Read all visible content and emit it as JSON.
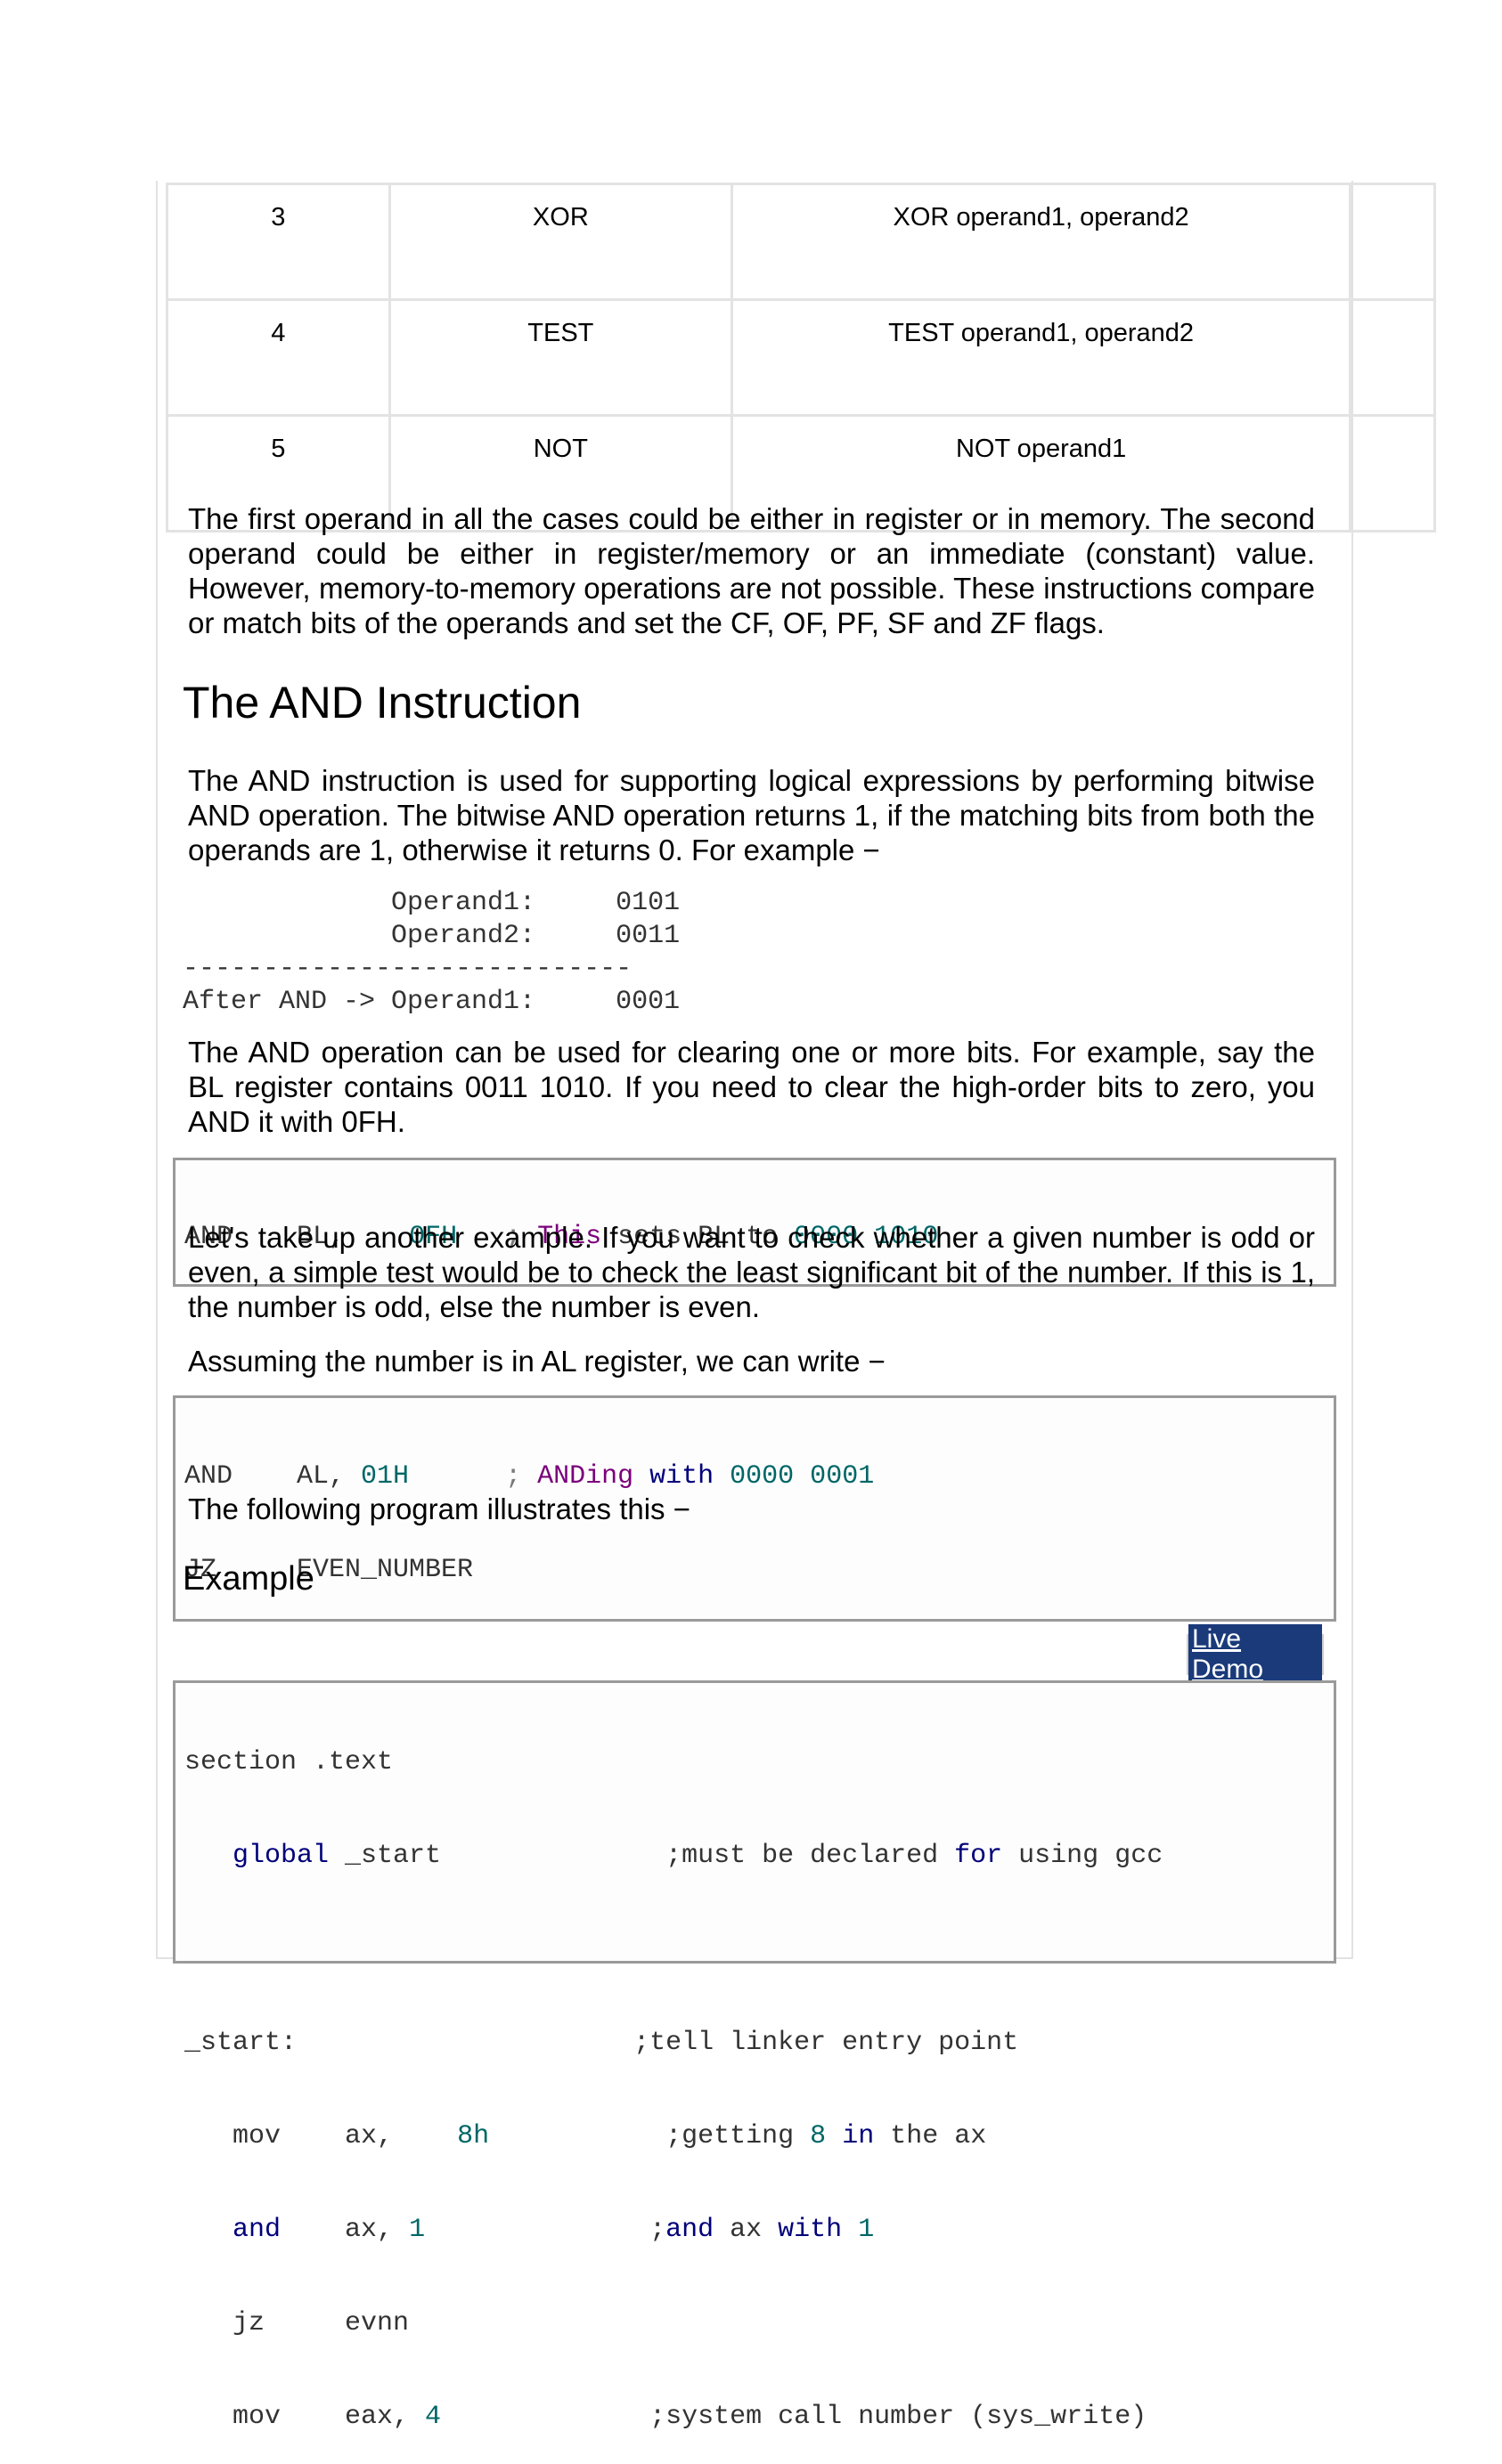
{
  "table": {
    "rows": [
      {
        "num": "3",
        "instr": "XOR",
        "format": "XOR operand1, operand2"
      },
      {
        "num": "4",
        "instr": "TEST",
        "format": "TEST operand1, operand2"
      },
      {
        "num": "5",
        "instr": "NOT",
        "format": "NOT operand1"
      }
    ]
  },
  "para_operands": "The first operand in all the cases could be either in register or in memory. The second operand could be either in register/memory or an immediate (constant) value. However, memory-to-memory operations are not possible. These instructions compare or match bits of the operands and set the CF, OF, PF, SF and ZF flags.",
  "heading_and": "The AND Instruction",
  "para_and": "The AND instruction is used for supporting logical expressions by performing bitwise AND operation. The bitwise AND operation returns 1, if the matching bits from both the operands are 1, otherwise it returns 0. For example −",
  "bitwise_example": {
    "line1": "             Operand1:     0101",
    "line2": "             Operand2:     0011",
    "line3": "----------------------------",
    "line4": "After AND -> Operand1:     0001"
  },
  "para_clear": "The AND operation can be used for clearing one or more bits. For example, say the BL register contains 0011 1010. If you need to clear the high-order bits to zero, you AND it with 0FH.",
  "code1": {
    "op": "AND    ",
    "reg": "BL,    ",
    "imm": "0FH",
    "gap": "   ",
    "semi": "; ",
    "c1": "This",
    "c2": " sets BL to ",
    "c3": "0000 1010"
  },
  "para_odd": "Let's take up another example. If you want to check whether a given number is odd or even, a simple test would be to check the least significant bit of the number. If this is 1, the number is odd, else the number is even.",
  "para_assume": "Assuming the number is in AL register, we can write −",
  "code2": {
    "l1_op": "AND    ",
    "l1_reg": "AL, ",
    "l1_imm": "01H",
    "l1_gap": "      ",
    "l1_semi": "; ",
    "l1_c1": "ANDing",
    "l1_c2": " with ",
    "l1_c3": "0000 0001",
    "l2": "JZ     EVEN_NUMBER"
  },
  "para_follow": "The following program illustrates this −",
  "example_heading": "Example",
  "live_demo": "Live Demo",
  "code3": {
    "l1": "section .text",
    "l2_kw": "   global",
    "l2_rest": " _start              ",
    "l2_cm1": ";must be declared ",
    "l2_cm2": "for",
    "l2_cm3": " using gcc",
    "l4_a": "_start:                     ",
    "l4_cm": ";tell linker entry point",
    "l5_a": "   mov    ax,    ",
    "l5_num": "8h",
    "l5_gap": "           ",
    "l5_cm1": ";getting ",
    "l5_cm2": "8",
    "l5_cm3": " ",
    "l5_cm4": "in",
    "l5_cm5": " the ax",
    "l6_kw": "   and",
    "l6_a": "    ax, ",
    "l6_num": "1",
    "l6_gap": "              ",
    "l6_cm1": ";",
    "l6_cm2": "and",
    "l6_cm3": " ax ",
    "l6_cm4": "with",
    "l6_cm5": " ",
    "l6_cm6": "1",
    "l7": "   jz     evnn",
    "l8_a": "   mov    eax, ",
    "l8_num": "4",
    "l8_gap": "             ",
    "l8_cm": ";system call number (sys_write)"
  }
}
